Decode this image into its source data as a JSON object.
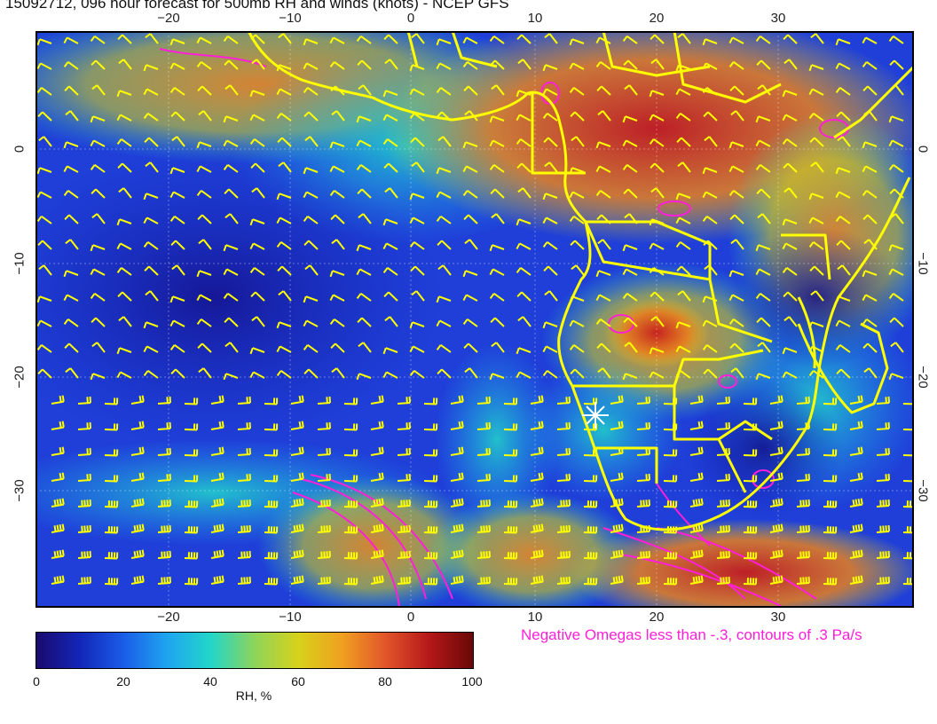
{
  "title": "15092712, 096 hour forecast for 500mb RH and winds (knots) - NCEP GFS",
  "axes": {
    "top_ticks": [
      "−20",
      "−10",
      "0",
      "10",
      "20",
      "30"
    ],
    "bottom_ticks": [
      "−20",
      "−10",
      "0",
      "10",
      "20",
      "30"
    ],
    "left_ticks": [
      "0",
      "−10",
      "−20",
      "−30"
    ],
    "right_ticks": [
      "0",
      "−10",
      "−20",
      "−30"
    ]
  },
  "map": {
    "lon_range": [
      -30,
      41
    ],
    "lat_range": [
      -40,
      10
    ],
    "gridlines": true,
    "marker": {
      "lon": 14.5,
      "lat": -23.5,
      "symbol": "white-star"
    }
  },
  "legend_note": "Negative Omegas less than -.3, contours of .3 Pa/s",
  "colorbar": {
    "ticks": [
      "0",
      "20",
      "40",
      "60",
      "80",
      "100"
    ],
    "label": "RH, %",
    "colors": [
      "#1a0a6e",
      "#1326b8",
      "#1a5de8",
      "#1fa5f0",
      "#22d6c9",
      "#8ed45a",
      "#d7d21a",
      "#f0a020",
      "#e2552a",
      "#b51818",
      "#6a0808"
    ]
  },
  "colors": {
    "coastline": "#ffff00",
    "barbs": "#ffff00",
    "omega_contours": "#ff1fd8",
    "ocean_base": "#1f35d8"
  }
}
